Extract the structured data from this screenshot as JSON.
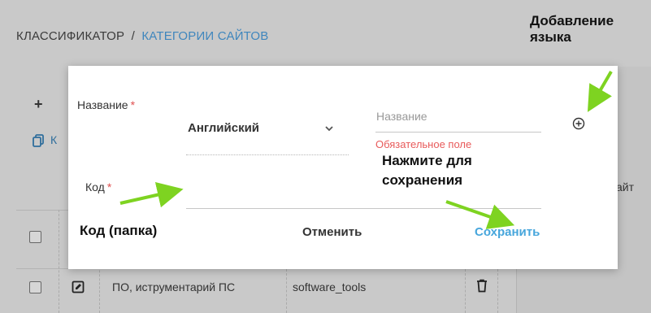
{
  "breadcrumb": {
    "root": "КЛАССИФИКАТОР",
    "separator": "/",
    "current": "КАТЕГОРИИ САЙТОВ"
  },
  "background": {
    "toolbar_add_icon": "plus-icon",
    "toolbar_copy_icon": "copy-icon",
    "partial_toolbar_text": "К",
    "partial_header_text": "айт",
    "row": {
      "name": "ПО, иструментарий ПС",
      "code": "software_tools"
    }
  },
  "modal": {
    "name_label": "Название",
    "required_mark": "*",
    "language_value": "Английский",
    "name_placeholder": "Название",
    "error_text": "Обязательное поле",
    "code_label": "Код",
    "cancel_label": "Отменить",
    "save_label": "Сохранить"
  },
  "annotations": {
    "add_language_line1": "Добавление",
    "add_language_line2": "языка",
    "code_note": "Код (папка)",
    "save_note_line1": "Нажмите для",
    "save_note_line2": "сохранения"
  },
  "colors": {
    "link": "#3f86bd",
    "save": "#47a6dc",
    "error": "#e85a5a",
    "arrow": "#7ed321",
    "overlay": "#c9c9c9"
  }
}
